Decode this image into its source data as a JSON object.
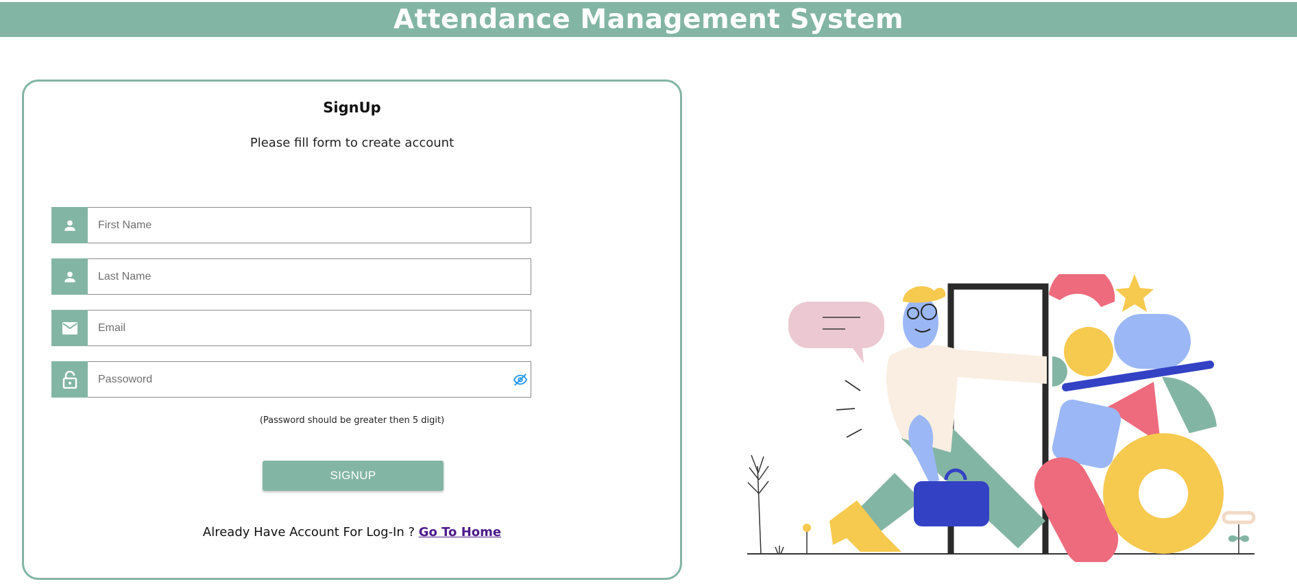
{
  "header": {
    "title": "Attendance Management System"
  },
  "form": {
    "title": "SignUp",
    "subtitle": "Please fill form to create account",
    "fields": [
      {
        "placeholder": "First Name",
        "icon": "person-icon"
      },
      {
        "placeholder": "Last Name",
        "icon": "person-icon"
      },
      {
        "placeholder": "Email",
        "icon": "mail-icon"
      },
      {
        "placeholder": "Passoword",
        "icon": "lock-icon"
      }
    ],
    "password_hint": "(Password should be greater then 5 digit)",
    "signup_label": "SIGNUP",
    "footer_text": "Already Have Account For Log-In ?",
    "home_link": "Go To Home"
  },
  "colors": {
    "accent": "#83b5a4",
    "link": "#4b1a8a",
    "eye": "#2196f3"
  }
}
